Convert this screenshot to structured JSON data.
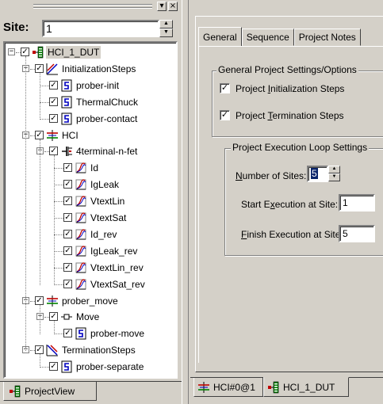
{
  "left_panel": {
    "site_label": "Site:",
    "site_value": "1",
    "tab_label": "ProjectView",
    "tree": [
      {
        "label": "HCI_1_DUT",
        "icon": "project-icon",
        "expander": "minus",
        "selected": true
      },
      {
        "label": "InitializationSteps",
        "icon": "init-steps-icon",
        "expander": "minus"
      },
      {
        "label": "prober-init",
        "icon": "script-icon"
      },
      {
        "label": "ThermalChuck",
        "icon": "script-icon"
      },
      {
        "label": "prober-contact",
        "icon": "script-icon"
      },
      {
        "label": "HCI",
        "icon": "subsite-icon",
        "expander": "minus"
      },
      {
        "label": "4terminal-n-fet",
        "icon": "device-icon",
        "expander": "minus"
      },
      {
        "label": "Id",
        "icon": "test-icon"
      },
      {
        "label": "IgLeak",
        "icon": "test-icon"
      },
      {
        "label": "VtextLin",
        "icon": "test-icon"
      },
      {
        "label": "VtextSat",
        "icon": "test-icon"
      },
      {
        "label": "Id_rev",
        "icon": "test-icon"
      },
      {
        "label": "IgLeak_rev",
        "icon": "test-icon"
      },
      {
        "label": "VtextLin_rev",
        "icon": "test-icon"
      },
      {
        "label": "VtextSat_rev",
        "icon": "test-icon"
      },
      {
        "label": "prober_move",
        "icon": "subsite-icon",
        "expander": "minus"
      },
      {
        "label": "Move",
        "icon": "move-icon",
        "expander": "minus"
      },
      {
        "label": "prober-move",
        "icon": "script-icon"
      },
      {
        "label": "TerminationSteps",
        "icon": "term-steps-icon",
        "expander": "minus"
      },
      {
        "label": "prober-separate",
        "icon": "script-icon"
      }
    ]
  },
  "right_panel": {
    "tabs": [
      {
        "label": "General",
        "active": true
      },
      {
        "label": "Sequence"
      },
      {
        "label": "Project Notes"
      }
    ],
    "general_group": {
      "title": "General Project Settings/Options",
      "init_steps": {
        "pre": "Project ",
        "u": "I",
        "post": "nitialization Steps",
        "checked": true
      },
      "term_steps": {
        "pre": "Project ",
        "u": "T",
        "post": "ermination Steps",
        "checked": true
      }
    },
    "loop_group": {
      "title": "Project Execution Loop Settings",
      "num_sites": {
        "u": "N",
        "post": "umber of Sites:",
        "value": "5"
      },
      "start_site": {
        "pre": "Start E",
        "u": "x",
        "post": "ecution at Site:",
        "value": "1"
      },
      "finish_site": {
        "u": "F",
        "post": "inish Execution at Site:",
        "value": "5"
      }
    },
    "bottom_tabs": [
      {
        "label": "HCI#0@1",
        "icon": "subsite-icon"
      },
      {
        "label": "HCI_1_DUT",
        "icon": "project-icon"
      }
    ]
  },
  "colors": {
    "face": "#d4d0c8",
    "selection": "#0a246a"
  }
}
